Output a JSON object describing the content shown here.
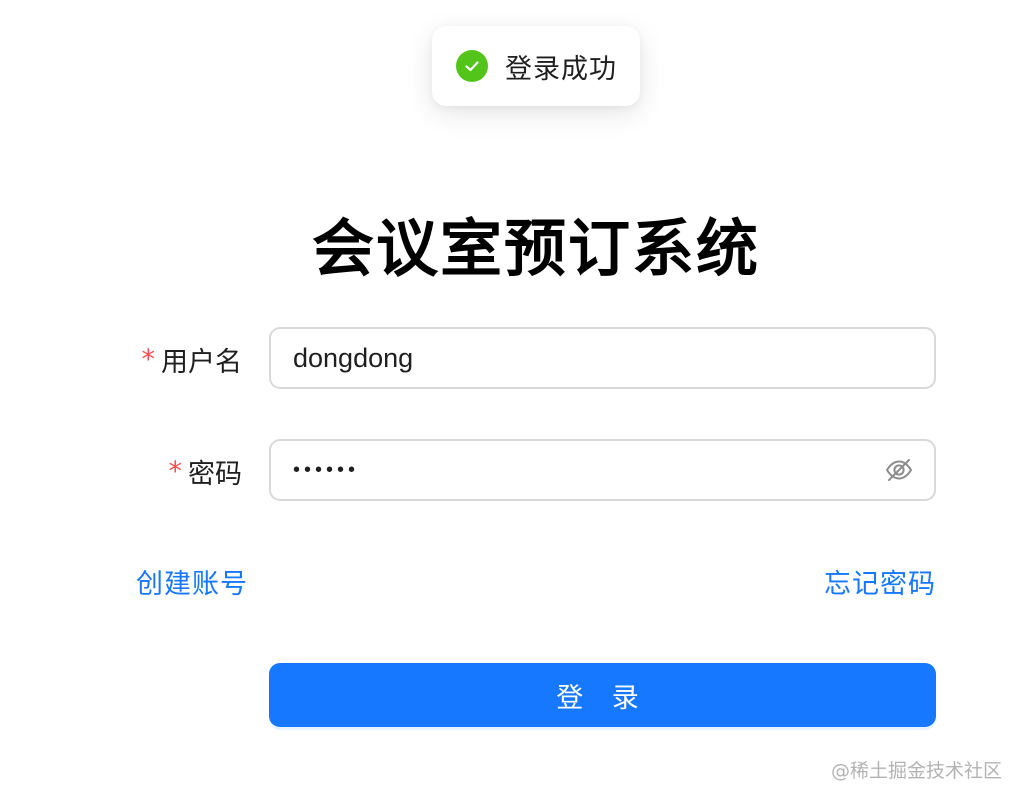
{
  "toast": {
    "icon": "check-circle-icon",
    "color": "#52c41a",
    "message": "登录成功"
  },
  "title": "会议室预订系统",
  "form": {
    "username": {
      "required_mark": "*",
      "label": "用户名",
      "value": "dongdong"
    },
    "password": {
      "required_mark": "*",
      "label": "密码",
      "value": "••••••",
      "toggle_icon": "eye-invisible-icon"
    }
  },
  "links": {
    "register": "创建账号",
    "forgot_password": "忘记密码"
  },
  "login_button": "登 录",
  "colors": {
    "primary": "#1677ff",
    "required": "#ff4d4f",
    "success": "#52c41a"
  },
  "watermark": "@稀土掘金技术社区"
}
